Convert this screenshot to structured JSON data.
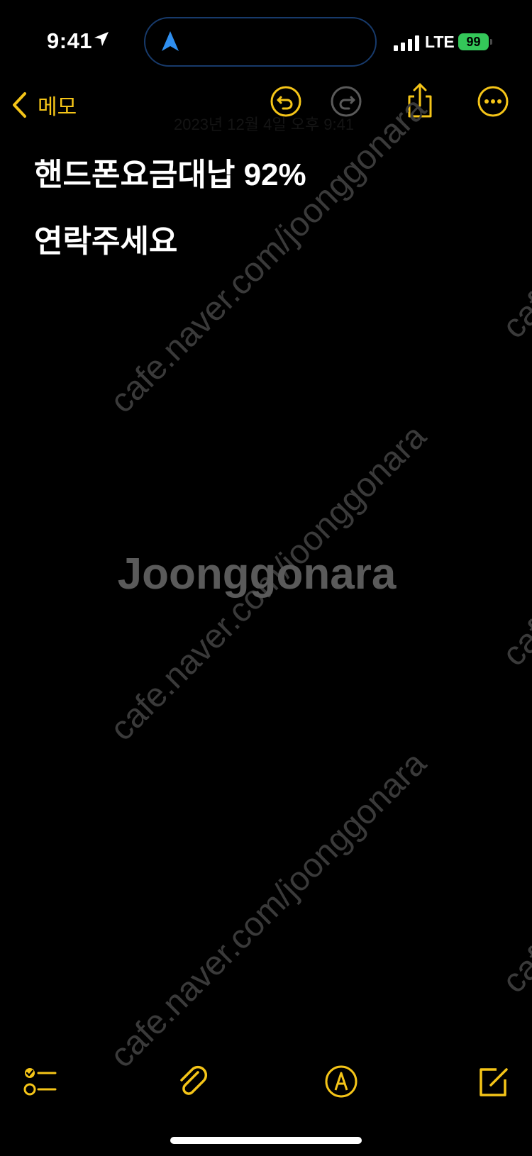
{
  "status_bar": {
    "time": "9:41",
    "network": "LTE",
    "battery": "99"
  },
  "nav": {
    "back_label": "메모",
    "accent_color": "#f5c518"
  },
  "header": {
    "faded_date": "2023년 12월 4일 오후 9:41"
  },
  "note": {
    "lines": [
      "핸드폰요금대납 92%",
      "연락주세요"
    ]
  },
  "watermark": {
    "logo": "Joonggonara",
    "url": "cafe.naver.com/joonggonara"
  },
  "icons": {
    "undo": "undo-icon",
    "redo": "redo-icon",
    "share": "share-icon",
    "more": "more-icon",
    "checklist": "checklist-icon",
    "attach": "paperclip-icon",
    "markup": "markup-pen-icon",
    "compose": "compose-icon"
  }
}
